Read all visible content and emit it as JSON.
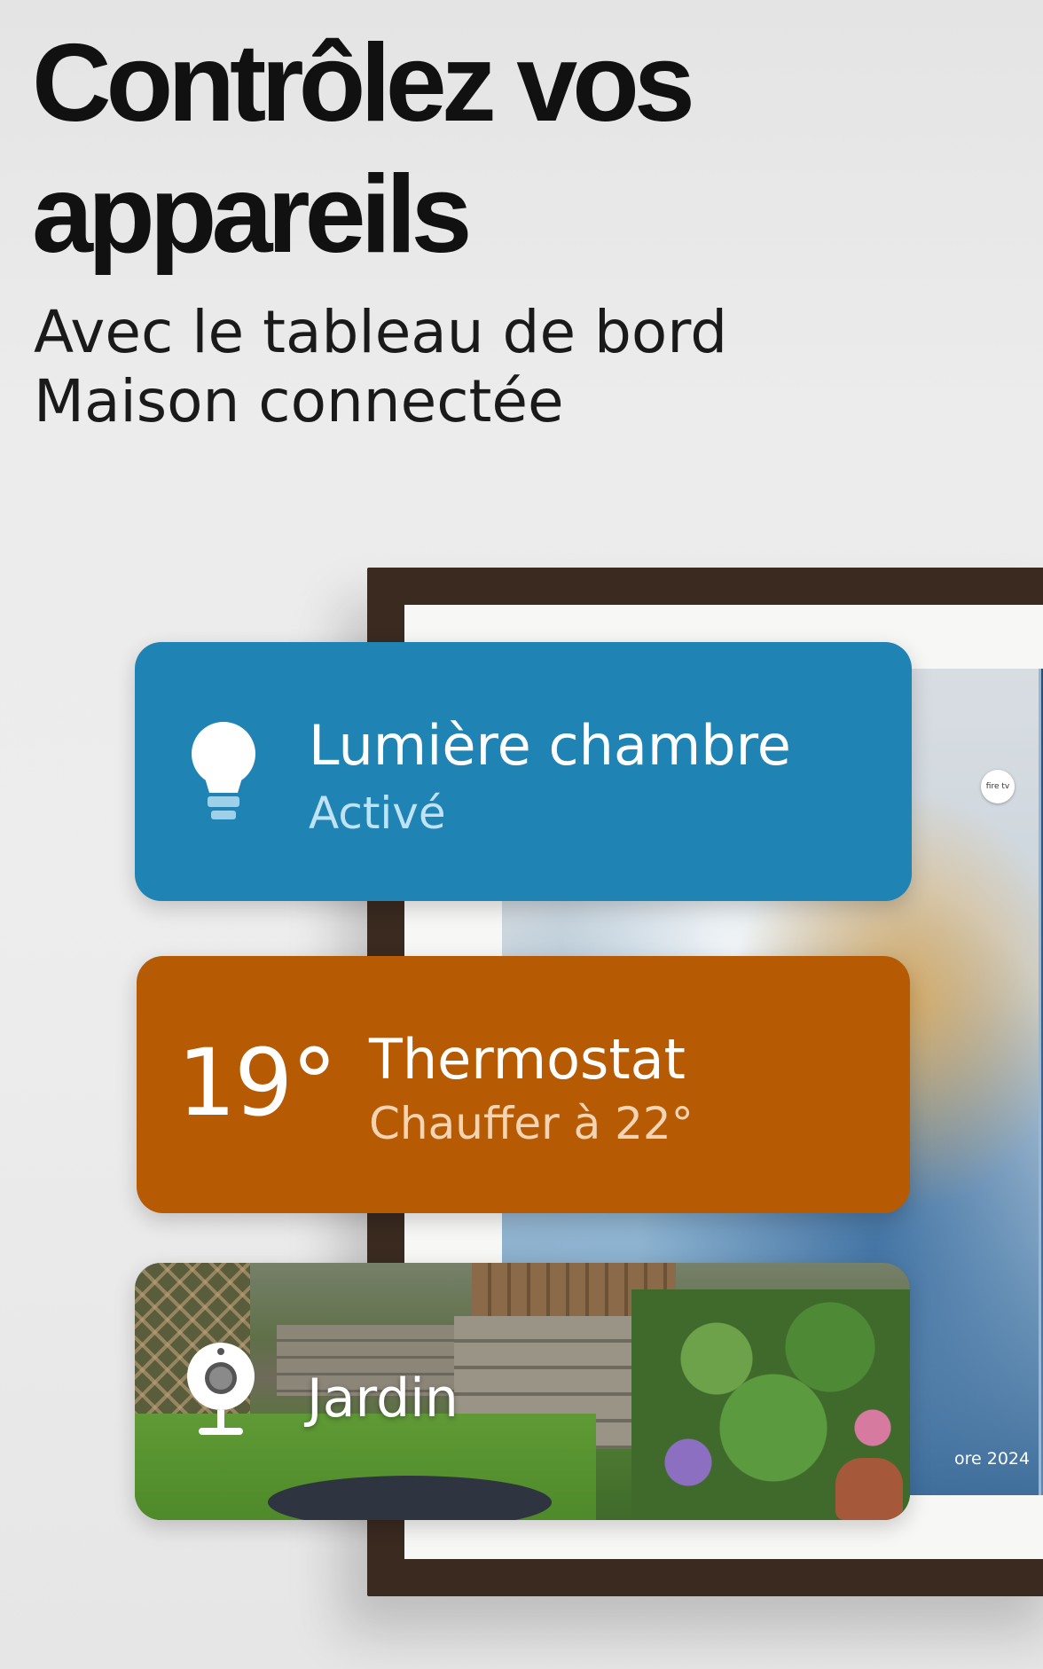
{
  "header": {
    "headline": "Contrôlez vos appareils",
    "subhead": "Avec le tableau de bord Maison connectée"
  },
  "tv": {
    "badge": "fire tv",
    "date_fragment": "ore 2024"
  },
  "cards": {
    "light": {
      "icon": "lightbulb-icon",
      "title": "Lumière chambre",
      "status": "Activé",
      "color": "#1f83b4"
    },
    "thermostat": {
      "temperature": "19°",
      "title": "Thermostat",
      "status": "Chauffer à 22°",
      "color": "#b65a04"
    },
    "camera": {
      "icon": "security-camera-icon",
      "title": "Jardin"
    }
  }
}
